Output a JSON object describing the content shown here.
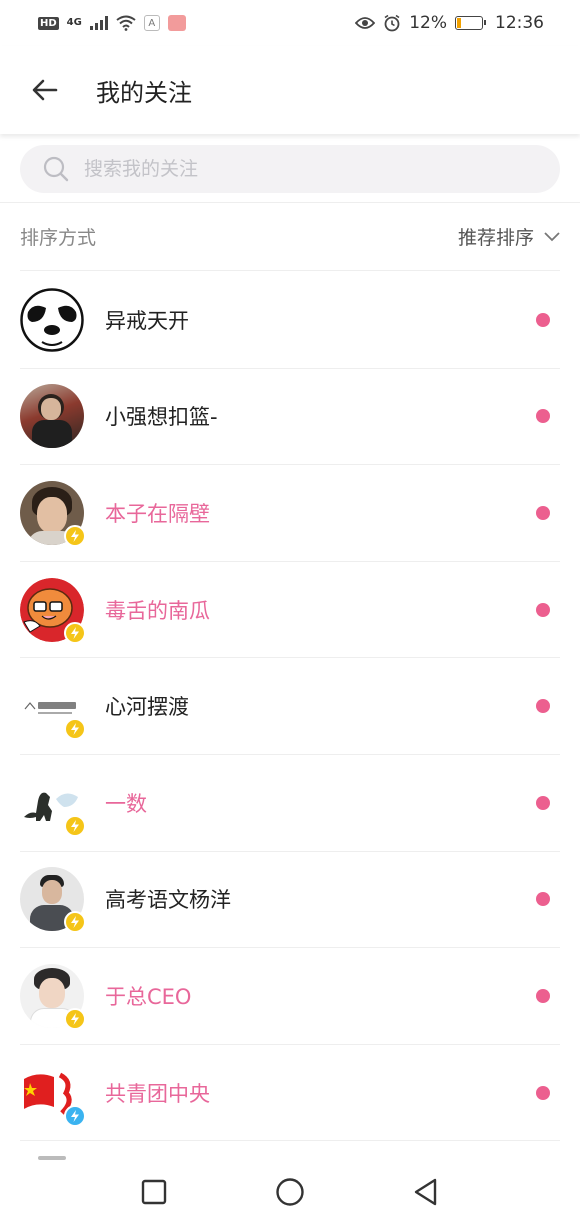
{
  "status_bar": {
    "hd": "HD",
    "network": "4G",
    "battery_percent": "12%",
    "time": "12:36",
    "icons": [
      "hd-icon",
      "signal-icon",
      "wifi-icon",
      "app-a-icon",
      "app-notification-icon",
      "eye-icon",
      "alarm-icon",
      "battery-icon"
    ]
  },
  "header": {
    "title": "我的关注",
    "back_icon": "arrow-left-icon"
  },
  "search": {
    "placeholder": "搜索我的关注",
    "value": ""
  },
  "sort": {
    "label": "排序方式",
    "selected": "推荐排序"
  },
  "following": [
    {
      "name": "异戒天开",
      "avatar": "panda",
      "badge": null,
      "name_color": "#222222"
    },
    {
      "name": "小强想扣篮-",
      "avatar": "photo-man-selfie",
      "badge": null,
      "name_color": "#222222"
    },
    {
      "name": "本子在隔壁",
      "avatar": "photo-young-man",
      "badge": "yellow",
      "name_color": "#e8679a"
    },
    {
      "name": "毒舌的南瓜",
      "avatar": "pumpkin-cartoon",
      "badge": "yellow",
      "name_color": "#e8679a"
    },
    {
      "name": "心河摆渡",
      "avatar": "logo-xinhe",
      "badge": "yellow",
      "name_color": "#222222"
    },
    {
      "name": "一数",
      "avatar": "godzilla",
      "badge": "yellow",
      "name_color": "#e8679a"
    },
    {
      "name": "高考语文杨洋",
      "avatar": "photo-teacher",
      "badge": "yellow",
      "name_color": "#222222"
    },
    {
      "name": "于总CEO",
      "avatar": "photo-boy",
      "badge": "yellow",
      "name_color": "#e8679a"
    },
    {
      "name": "共青团中央",
      "avatar": "flag",
      "badge": "blue",
      "name_color": "#e8679a"
    }
  ],
  "colors": {
    "accent": "#ec5f8f",
    "badge_yellow": "#f5c518",
    "badge_blue": "#3ab3f0"
  },
  "nav": {
    "icons": [
      "square-recent-icon",
      "circle-home-icon",
      "triangle-back-icon"
    ]
  }
}
